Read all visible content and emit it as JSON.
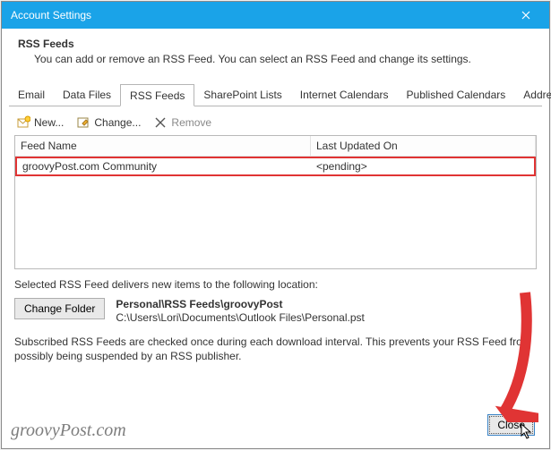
{
  "window": {
    "title": "Account Settings"
  },
  "header": {
    "title": "RSS Feeds",
    "subtitle": "You can add or remove an RSS Feed. You can select an RSS Feed and change its settings."
  },
  "tabs": [
    {
      "label": "Email"
    },
    {
      "label": "Data Files"
    },
    {
      "label": "RSS Feeds",
      "active": true
    },
    {
      "label": "SharePoint Lists"
    },
    {
      "label": "Internet Calendars"
    },
    {
      "label": "Published Calendars"
    },
    {
      "label": "Address Books"
    }
  ],
  "toolbar": {
    "new": "New...",
    "change": "Change...",
    "remove": "Remove"
  },
  "list": {
    "columns": {
      "name": "Feed Name",
      "updated": "Last Updated On"
    },
    "rows": [
      {
        "name": "groovyPost.com Community",
        "updated": "<pending>"
      }
    ]
  },
  "location": {
    "intro": "Selected RSS Feed delivers new items to the following location:",
    "change_btn": "Change Folder",
    "path_display": "Personal\\RSS Feeds\\groovyPost",
    "file_path": "C:\\Users\\Lori\\Documents\\Outlook Files\\Personal.pst"
  },
  "note": "Subscribed RSS Feeds are checked once during each download interval. This prevents your RSS Feed from possibly being suspended by an RSS publisher.",
  "footer": {
    "close": "Close"
  },
  "watermark": "groovyPost.com"
}
